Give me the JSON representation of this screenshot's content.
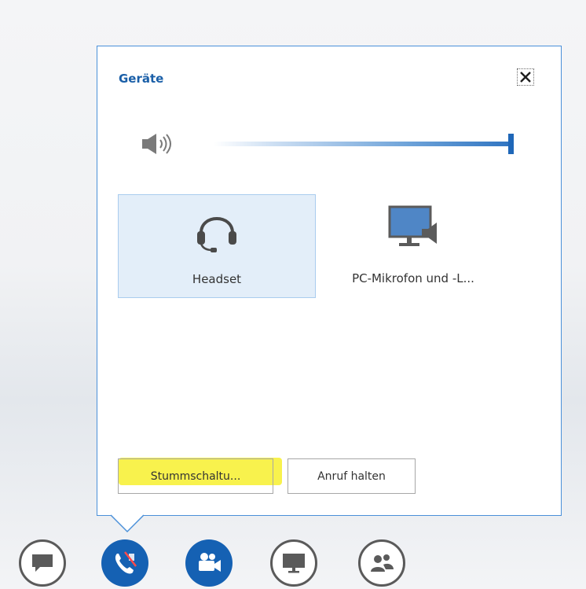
{
  "popup": {
    "title": "Geräte",
    "close_icon": "close-icon",
    "volume": {
      "speaker_icon": "speaker-icon",
      "level": 1.0
    },
    "devices": [
      {
        "label": "Headset",
        "icon": "headset-icon",
        "selected": true
      },
      {
        "label": "PC-Mikrofon und -L...",
        "icon": "monitor-speaker-icon",
        "selected": false
      }
    ],
    "buttons": {
      "mute_label": "Stummschaltu...",
      "hold_label": "Anruf halten"
    },
    "highlight_color": "#f7f13a"
  },
  "controls": [
    {
      "name": "im",
      "icon": "chat-icon",
      "active": false
    },
    {
      "name": "audio",
      "icon": "phone-muted-icon",
      "active": true
    },
    {
      "name": "video",
      "icon": "video-camera-icon",
      "active": true
    },
    {
      "name": "present",
      "icon": "monitor-icon",
      "active": false
    },
    {
      "name": "participants",
      "icon": "people-icon",
      "active": false
    }
  ],
  "colors": {
    "accent": "#1561b3",
    "title": "#1a5fa8",
    "border": "#4a90d9",
    "selected_tile": "#e3eef9"
  }
}
